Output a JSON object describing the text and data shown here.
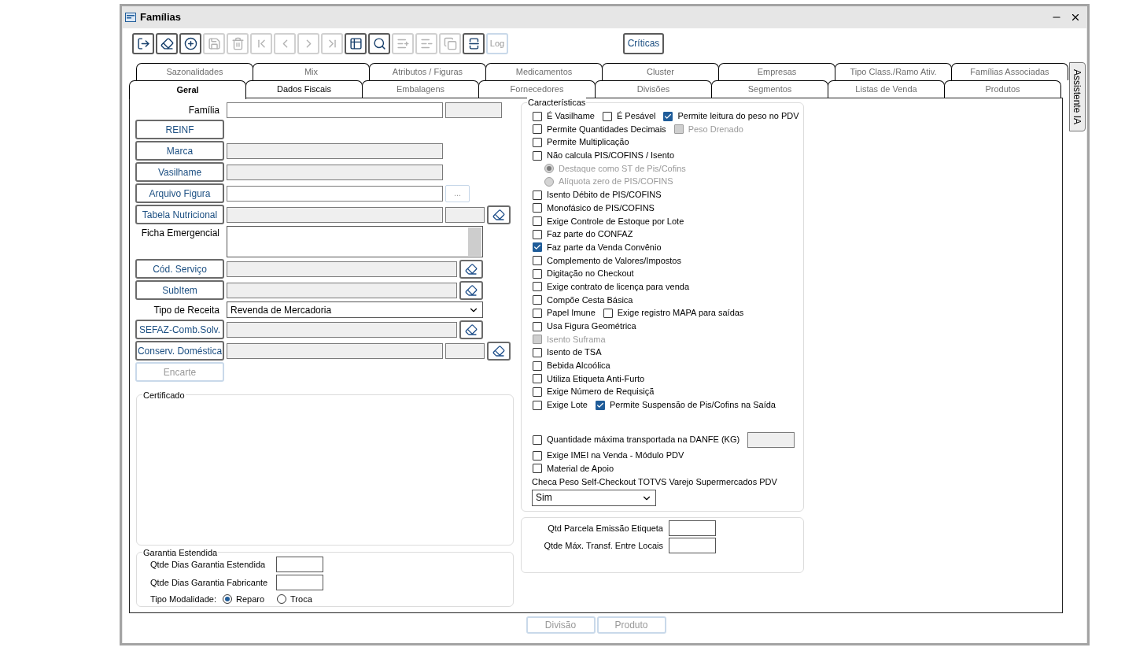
{
  "window": {
    "title": "Famílias"
  },
  "toolbar": {
    "buttons": [
      {
        "disabled": false
      },
      {
        "disabled": false
      },
      {
        "disabled": false
      },
      {
        "disabled": true
      },
      {
        "disabled": true
      },
      {
        "disabled": true
      },
      {
        "disabled": true
      },
      {
        "disabled": true
      },
      {
        "disabled": true
      },
      {
        "disabled": false
      },
      {
        "disabled": false
      },
      {
        "disabled": true
      },
      {
        "disabled": true
      },
      {
        "disabled": true
      },
      {
        "disabled": false
      }
    ],
    "log_button": {
      "label": "Log",
      "disabled": true
    },
    "criticas_button": {
      "label": "Críticas"
    }
  },
  "tabs_back_row": [
    {
      "label": "Sazonalidades",
      "selected": false
    },
    {
      "label": "Mix",
      "selected": false
    },
    {
      "label": "Atributos / Figuras",
      "selected": false
    },
    {
      "label": "Medicamentos",
      "selected": false
    },
    {
      "label": "Cluster",
      "selected": false
    },
    {
      "label": "Empresas",
      "selected": false
    },
    {
      "label": "Tipo Class./Ramo Ativ.",
      "selected": false
    },
    {
      "label": "Famílias Associadas",
      "selected": false
    }
  ],
  "tabs_front_row": [
    {
      "label": "Geral",
      "selected": true,
      "emphasized": true
    },
    {
      "label": "Dados Fiscais",
      "selected": false,
      "emphasized": true
    },
    {
      "label": "Embalagens",
      "selected": false,
      "emphasized": false
    },
    {
      "label": "Fornecedores",
      "selected": false,
      "emphasized": false
    },
    {
      "label": "Divisões",
      "selected": false,
      "emphasized": false
    },
    {
      "label": "Segmentos",
      "selected": false,
      "emphasized": false
    },
    {
      "label": "Listas de Venda",
      "selected": false,
      "emphasized": false
    },
    {
      "label": "Produtos",
      "selected": false,
      "emphasized": false
    }
  ],
  "side_tab": {
    "label": "Assistente IA"
  },
  "left_form": [
    {
      "kind": "label",
      "label": "Família",
      "fields": [
        {
          "kind": "input",
          "disabled": false
        },
        {
          "kind": "code",
          "disabled": true
        }
      ],
      "clear_button": false
    },
    {
      "kind": "button",
      "label": "REINF",
      "disabled": false,
      "clear_button": false
    },
    {
      "kind": "button",
      "label": "Marca",
      "disabled": false,
      "fields": [
        {
          "kind": "input",
          "disabled": true
        }
      ],
      "clear_button": false
    },
    {
      "kind": "button",
      "label": "Vasilhame",
      "disabled": false,
      "fields": [
        {
          "kind": "input",
          "disabled": true
        }
      ],
      "clear_button": false
    },
    {
      "kind": "button",
      "label": "Arquivo Figura",
      "disabled": false,
      "fields": [
        {
          "kind": "input",
          "disabled": false
        },
        {
          "kind": "browse",
          "label": "...",
          "disabled": true
        }
      ],
      "clear_button": false
    },
    {
      "kind": "button",
      "label": "Tabela Nutricional",
      "disabled": false,
      "fields": [
        {
          "kind": "input",
          "disabled": true
        },
        {
          "kind": "code",
          "disabled": true
        }
      ],
      "clear_button": true
    },
    {
      "kind": "label",
      "label": "Ficha Emergencial",
      "fields": [
        {
          "kind": "memo",
          "disabled": false
        }
      ],
      "clear_button": false
    },
    {
      "kind": "button",
      "label": "Cód. Serviço",
      "disabled": false,
      "fields": [
        {
          "kind": "input",
          "disabled": true
        }
      ],
      "clear_button": true
    },
    {
      "kind": "button",
      "label": "SubItem",
      "disabled": false,
      "fields": [
        {
          "kind": "input",
          "disabled": true
        }
      ],
      "clear_button": true
    },
    {
      "kind": "label",
      "label": "Tipo de Receita",
      "fields": [
        {
          "kind": "select",
          "value": "Revenda de Mercadoria",
          "disabled": false
        }
      ],
      "clear_button": false
    },
    {
      "kind": "button",
      "label": "SEFAZ-Comb.Solv.",
      "disabled": false,
      "fields": [
        {
          "kind": "input",
          "disabled": true
        }
      ],
      "clear_button": true
    },
    {
      "kind": "button",
      "label": "Conserv. Doméstica",
      "disabled": false,
      "fields": [
        {
          "kind": "input",
          "disabled": true
        },
        {
          "kind": "code",
          "disabled": true
        }
      ],
      "clear_button": true
    },
    {
      "kind": "button",
      "label": "Encarte",
      "disabled": true,
      "clear_button": false
    }
  ],
  "certificado": {
    "title": "Certificado"
  },
  "garantia": {
    "title": "Garantia Estendida",
    "fields": [
      {
        "label": "Qtde Dias Garantia Estendida"
      },
      {
        "label": "Qtde Dias Garantia Fabricante"
      }
    ],
    "modalidade": {
      "label": "Tipo Modalidade:",
      "options": [
        {
          "label": "Reparo",
          "selected": true
        },
        {
          "label": "Troca",
          "selected": false
        }
      ]
    }
  },
  "caracteristicas": {
    "title": "Características",
    "lines": [
      [
        {
          "kind": "checkbox",
          "label": "É Vasilhame",
          "checked": false,
          "disabled": false
        },
        {
          "kind": "checkbox",
          "label": "É Pesável",
          "checked": false,
          "disabled": false
        },
        {
          "kind": "checkbox",
          "label": "Permite leitura do peso no PDV",
          "checked": true,
          "disabled": false
        }
      ],
      [
        {
          "kind": "checkbox",
          "label": "Permite Quantidades Decimais",
          "checked": false,
          "disabled": false
        },
        {
          "kind": "checkbox",
          "label": "Peso Drenado",
          "checked": false,
          "disabled": true
        }
      ],
      [
        {
          "kind": "checkbox",
          "label": "Permite Multiplicação",
          "checked": false,
          "disabled": false
        }
      ],
      [
        {
          "kind": "checkbox",
          "label": "Não calcula PIS/COFINS / Isento",
          "checked": false,
          "disabled": false
        }
      ],
      [
        {
          "kind": "radio",
          "label": "Destaque como ST de Pis/Cofins",
          "selected": true,
          "disabled": true
        }
      ],
      [
        {
          "kind": "radio",
          "label": "Alíquota zero de PIS/COFINS",
          "selected": false,
          "disabled": true
        }
      ],
      [
        {
          "kind": "checkbox",
          "label": "Isento Débito de PIS/COFINS",
          "checked": false,
          "disabled": false
        }
      ],
      [
        {
          "kind": "checkbox",
          "label": "Monofásico de PIS/COFINS",
          "checked": false,
          "disabled": false
        }
      ],
      [
        {
          "kind": "checkbox",
          "label": "Exige Controle de Estoque por Lote",
          "checked": false,
          "disabled": false
        }
      ],
      [
        {
          "kind": "checkbox",
          "label": "Faz parte do CONFAZ",
          "checked": false,
          "disabled": false
        }
      ],
      [
        {
          "kind": "checkbox",
          "label": "Faz parte da Venda Convênio",
          "checked": true,
          "disabled": false
        }
      ],
      [
        {
          "kind": "checkbox",
          "label": "Complemento de Valores/Impostos",
          "checked": false,
          "disabled": false
        }
      ],
      [
        {
          "kind": "checkbox",
          "label": "Digitação no Checkout",
          "checked": false,
          "disabled": false
        }
      ],
      [
        {
          "kind": "checkbox",
          "label": "Exige contrato de licença para venda",
          "checked": false,
          "disabled": false
        }
      ],
      [
        {
          "kind": "checkbox",
          "label": "Compõe Cesta Básica",
          "checked": false,
          "disabled": false
        }
      ],
      [
        {
          "kind": "checkbox",
          "label": "Papel Imune",
          "checked": false,
          "disabled": false
        },
        {
          "kind": "checkbox",
          "label": "Exige registro MAPA para saídas",
          "checked": false,
          "disabled": false
        }
      ],
      [
        {
          "kind": "checkbox",
          "label": "Usa Figura Geométrica",
          "checked": false,
          "disabled": false
        }
      ],
      [
        {
          "kind": "checkbox",
          "label": "Isento Suframa",
          "checked": false,
          "disabled": true
        }
      ],
      [
        {
          "kind": "checkbox",
          "label": "Isento de TSA",
          "checked": false,
          "disabled": false
        }
      ],
      [
        {
          "kind": "checkbox",
          "label": "Bebida Alcoólica",
          "checked": false,
          "disabled": false
        }
      ],
      [
        {
          "kind": "checkbox",
          "label": "Utiliza Etiqueta Anti-Furto",
          "checked": false,
          "disabled": false
        }
      ],
      [
        {
          "kind": "checkbox",
          "label": "Exige Número de Requisiçã",
          "checked": false,
          "disabled": false
        }
      ],
      [
        {
          "kind": "checkbox",
          "label": "Exige Lote",
          "checked": false,
          "disabled": false
        },
        {
          "kind": "checkbox",
          "label": "Permite Suspensão de Pis/Cofins na Saída",
          "checked": true,
          "disabled": false
        }
      ],
      [
        {
          "kind": "spacer"
        }
      ],
      [
        {
          "kind": "checkbox",
          "label": "Quantidade máxima transportada na DANFE (KG)",
          "checked": false,
          "disabled": false
        },
        {
          "kind": "input",
          "disabled": true
        }
      ],
      [
        {
          "kind": "checkbox",
          "label": "Exige IMEI na Venda - Módulo PDV",
          "checked": false,
          "disabled": false
        }
      ],
      [
        {
          "kind": "checkbox",
          "label": "Material de Apoio",
          "checked": false,
          "disabled": false
        }
      ]
    ],
    "select_label": "Checa Peso Self-Checkout TOTVS Varejo Supermercados PDV",
    "select_value": "Sim"
  },
  "quantidades": [
    {
      "label": "Qtd Parcela Emissão Etiqueta"
    },
    {
      "label": "Qtde Máx. Transf. Entre Locais"
    }
  ],
  "footer_buttons": [
    {
      "label": "Divisão",
      "disabled": true
    },
    {
      "label": "Produto",
      "disabled": true
    }
  ]
}
